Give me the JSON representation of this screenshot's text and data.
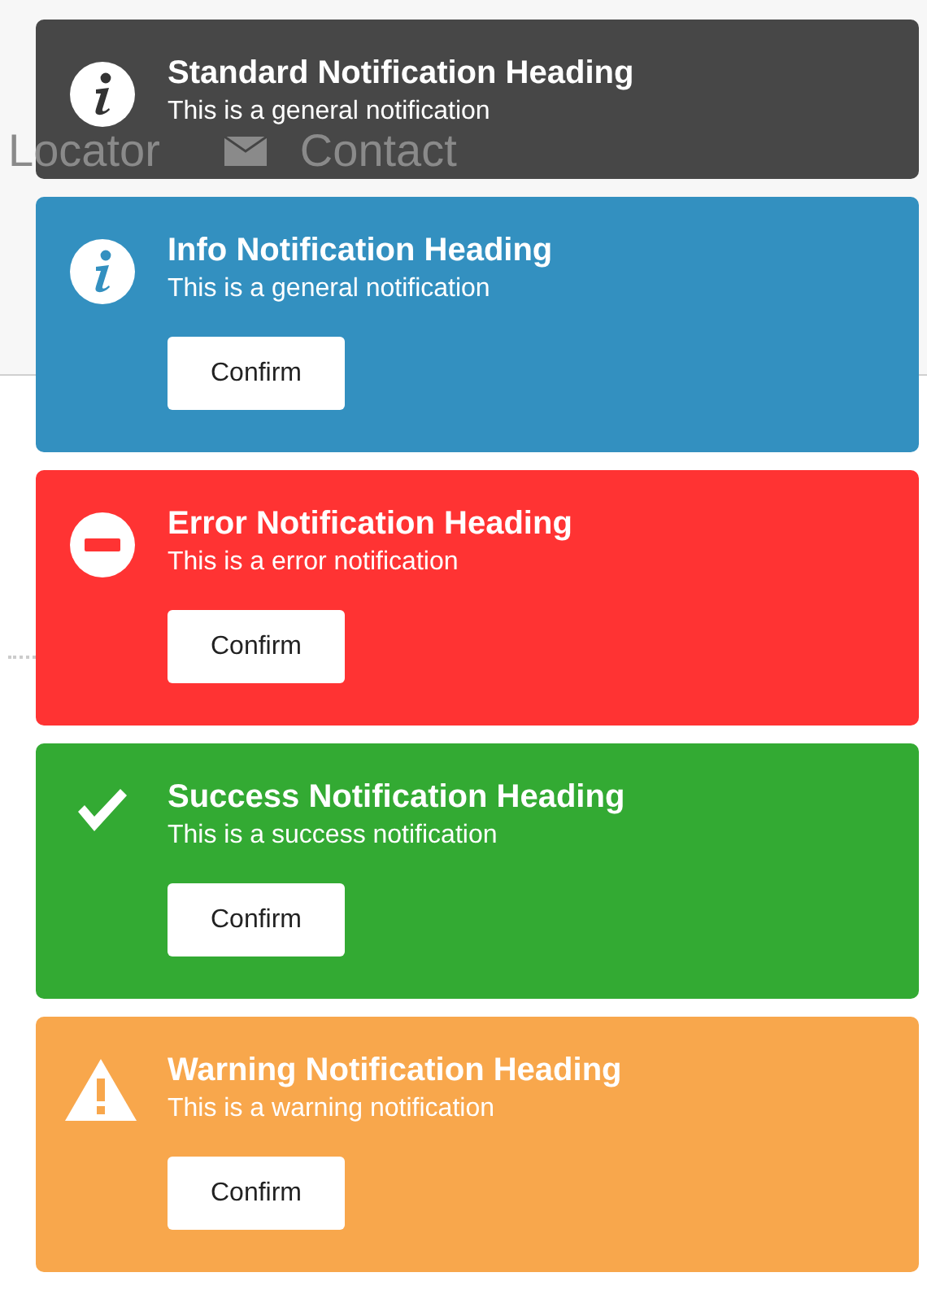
{
  "background_nav": [
    {
      "kind": "text",
      "label": "Locator"
    },
    {
      "kind": "mail",
      "label": "Contact"
    }
  ],
  "notifications": [
    {
      "kind": "standard",
      "heading": "Standard Notification Heading",
      "message": "This is a general notification"
    },
    {
      "kind": "info",
      "heading": "Info Notification Heading",
      "message": "This is a general notification",
      "button": "Confirm"
    },
    {
      "kind": "error",
      "heading": "Error Notification Heading",
      "message": "This is a error notification",
      "button": "Confirm"
    },
    {
      "kind": "success",
      "heading": "Success Notification Heading",
      "message": "This is a success notification",
      "button": "Confirm"
    },
    {
      "kind": "warning",
      "heading": "Warning Notification Heading",
      "message": "This is a warning notification",
      "button": "Confirm"
    }
  ]
}
